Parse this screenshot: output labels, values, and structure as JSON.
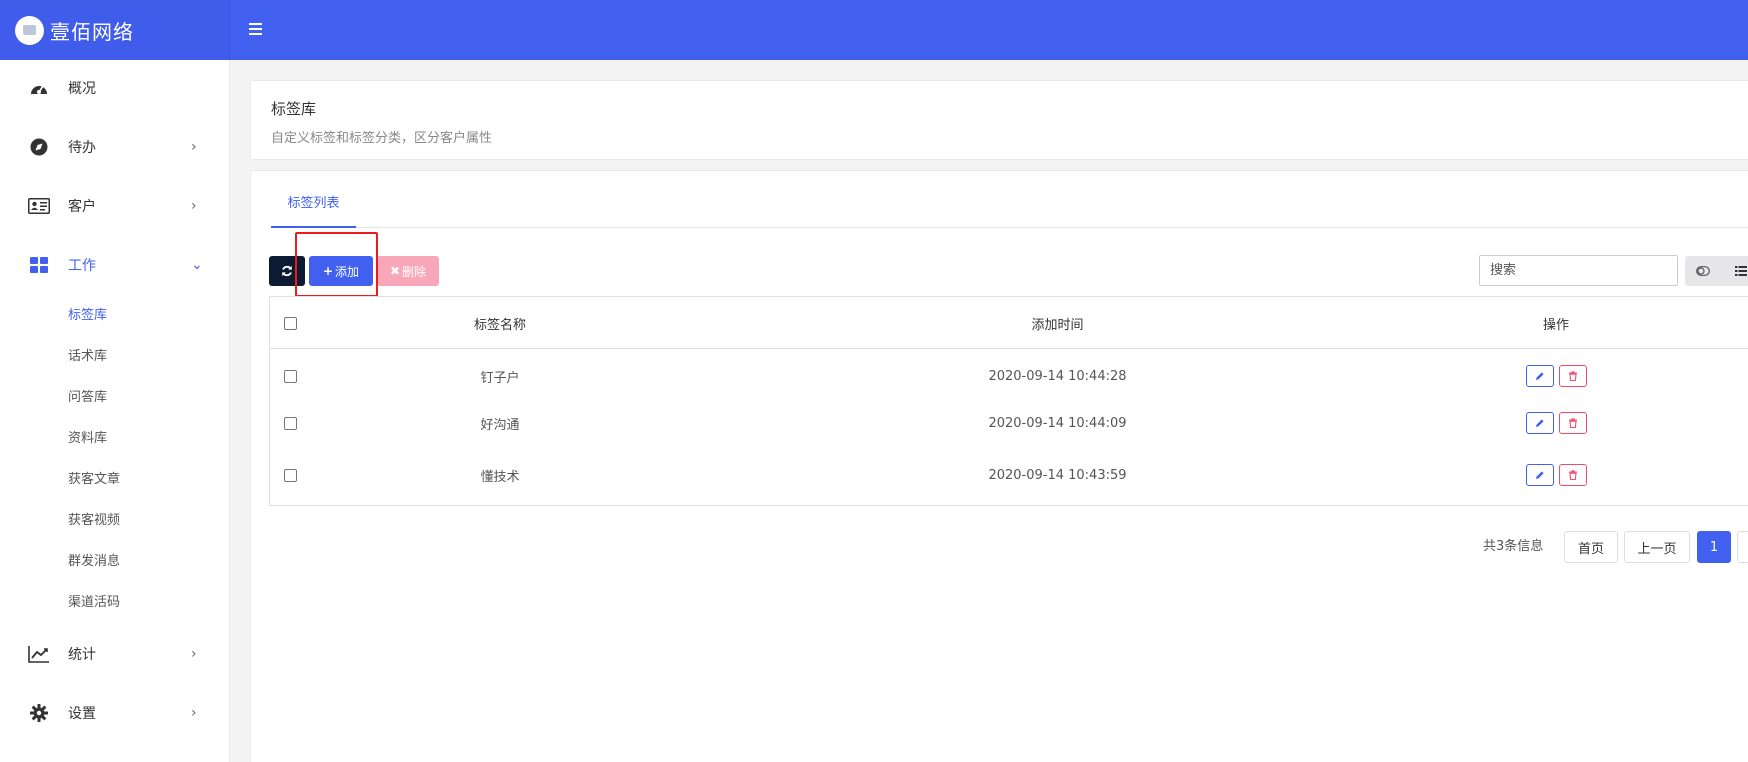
{
  "brand": {
    "name": "壹佰网络"
  },
  "sidebar": {
    "items": [
      {
        "label": "概况"
      },
      {
        "label": "待办"
      },
      {
        "label": "客户"
      },
      {
        "label": "工作"
      },
      {
        "label": "统计"
      },
      {
        "label": "设置"
      }
    ],
    "work_sub": [
      "标签库",
      "话术库",
      "问答库",
      "资料库",
      "获客文章",
      "获客视频",
      "群发消息",
      "渠道活码"
    ]
  },
  "header_card": {
    "title": "标签库",
    "subtitle": "自定义标签和标签分类，区分客户属性"
  },
  "tabs": [
    "标签列表"
  ],
  "toolbar": {
    "add_label": "添加",
    "delete_label": "删除",
    "search_placeholder": "搜索"
  },
  "table": {
    "columns": [
      "标签名称",
      "添加时间",
      "操作"
    ],
    "rows": [
      {
        "name": "钉子户",
        "time": "2020-09-14 10:44:28"
      },
      {
        "name": "好沟通",
        "time": "2020-09-14 10:44:09"
      },
      {
        "name": "懂技术",
        "time": "2020-09-14 10:43:59"
      }
    ]
  },
  "pagination": {
    "info": "共3条信息",
    "first": "首页",
    "prev": "上一页",
    "current": "1"
  },
  "colors": {
    "primary": "#4160f0",
    "danger": "#ef4d6b",
    "danger_light": "#f7a7b8",
    "dark": "#0d1a33",
    "highlight": "#ec1c1c"
  }
}
